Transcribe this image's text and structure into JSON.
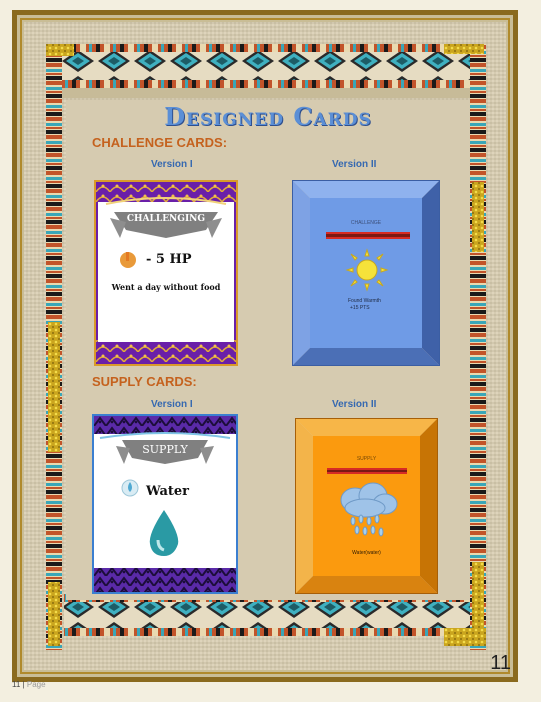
{
  "title": "Designed Cards",
  "sections": {
    "challenge": "CHALLENGE CARDS:",
    "supply": "SUPPLY CARDS:"
  },
  "versions": {
    "v1": "Version I",
    "v2": "Version II"
  },
  "challenge_v1": {
    "banner": "CHALLENGING",
    "hp": "- 5 HP",
    "text": "Went a day without food"
  },
  "challenge_v2": {
    "label": "CHALLENGE",
    "line1": "Found Warmth",
    "line2": "+15 PTS"
  },
  "supply_v1": {
    "banner": "SUPPLY",
    "item": "Water"
  },
  "supply_v2": {
    "label": "SUPPLY",
    "text": "Water(water)"
  },
  "page_number": "11",
  "footer": {
    "number": "11",
    "sep": "|",
    "word": "Page"
  },
  "colors": {
    "title": "#5b8fd6",
    "section": "#c5621e",
    "version": "#3568b0"
  }
}
